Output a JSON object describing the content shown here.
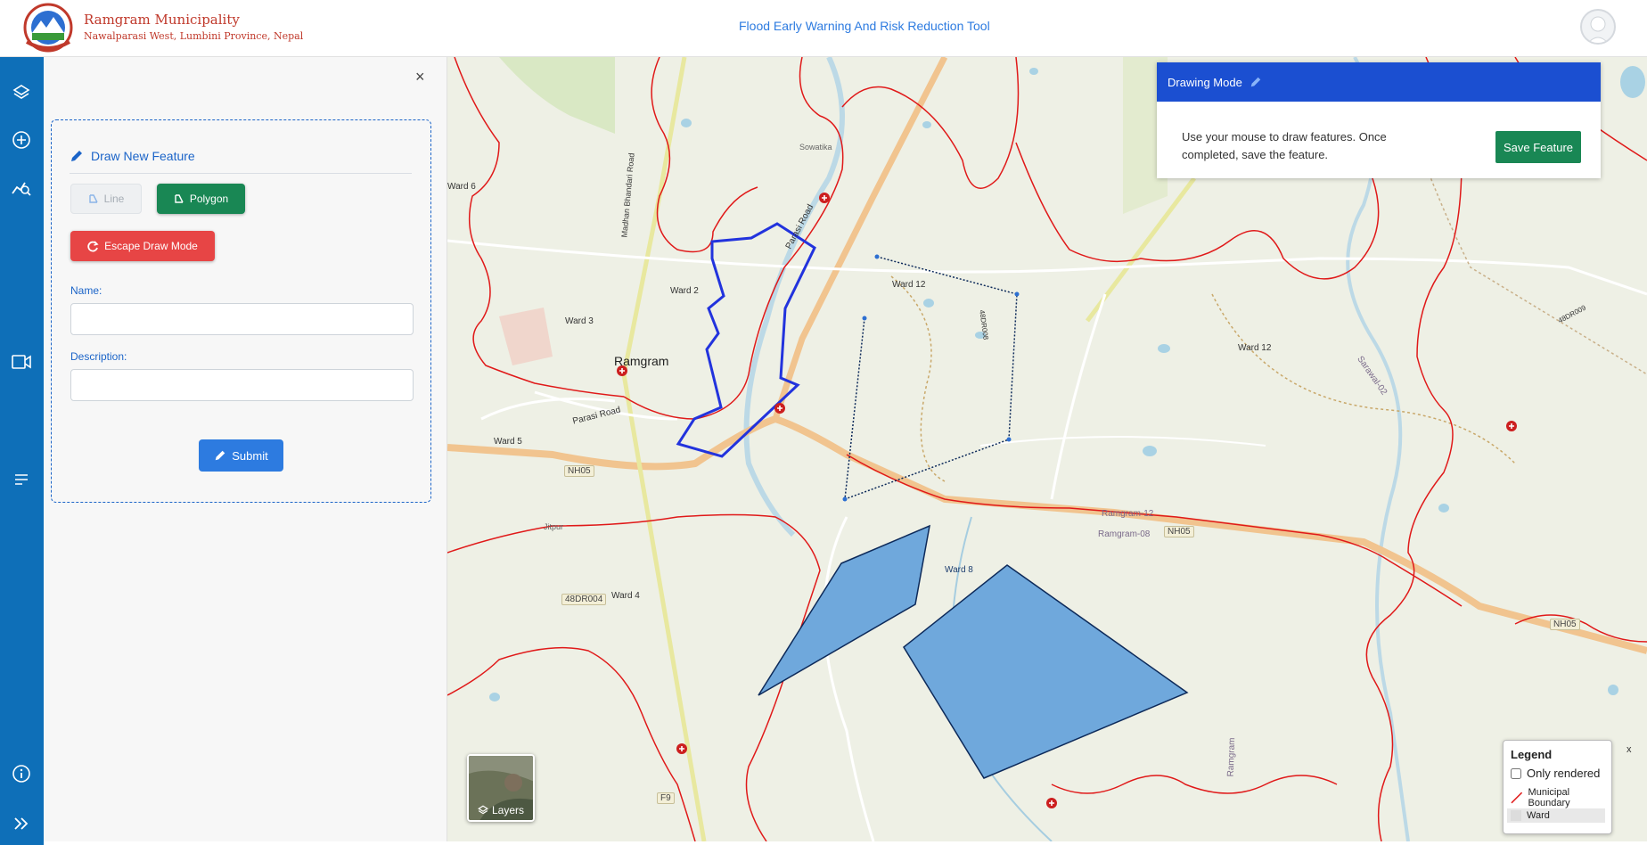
{
  "header": {
    "org_name": "Ramgram Municipality",
    "org_sub": "Nawalparasi West, Lumbini Province, Nepal",
    "app_title": "Flood Early Warning And Risk Reduction Tool"
  },
  "rail": {
    "icons": [
      "layers-icon",
      "add-circle-icon",
      "analytics-icon",
      "video-icon",
      "menu-lines-icon",
      "info-icon",
      "expand-icon"
    ]
  },
  "panel": {
    "close": "×",
    "heading": "Draw New Feature",
    "line_label": "Line",
    "polygon_label": "Polygon",
    "escape_label": "Escape Draw Mode",
    "name_label": "Name:",
    "name_value": "",
    "description_label": "Description:",
    "description_value": "",
    "submit_label": "Submit"
  },
  "drawing_card": {
    "title": "Drawing Mode",
    "text": "Use your mouse to draw features. Once completed, save the feature.",
    "save_label": "Save Feature"
  },
  "map": {
    "place_labels": [
      "Ramgram",
      "Ward 2",
      "Ward 3",
      "Ward 4",
      "Ward 5",
      "Ward 6",
      "Ward 8",
      "Ward 12",
      "Ward 12",
      "Sowatika",
      "Jitpur",
      "Ramgram-12",
      "Ramgram-08",
      "Parasi Road",
      "Parasi Road",
      "Madhan Bhandari Road",
      "Sarawal-02",
      "Ramgram",
      "48DR008",
      "48DR009"
    ],
    "road_badges": [
      "NH05",
      "NH05",
      "NH05",
      "48DR004",
      "F9"
    ]
  },
  "legend": {
    "title": "Legend",
    "close": "x",
    "only_rendered": "Only rendered",
    "only_rendered_checked": false,
    "items": [
      "Municipal Boundary",
      "Ward"
    ]
  },
  "layers_label": "Layers",
  "colors": {
    "rail": "#0e6fb8",
    "accent_blue": "#2d7be0",
    "drawing_header": "#1b4fd1",
    "success": "#198754",
    "danger": "#e74545",
    "boundary": "#e01919",
    "polygon_fill": "#6fa8dc"
  }
}
